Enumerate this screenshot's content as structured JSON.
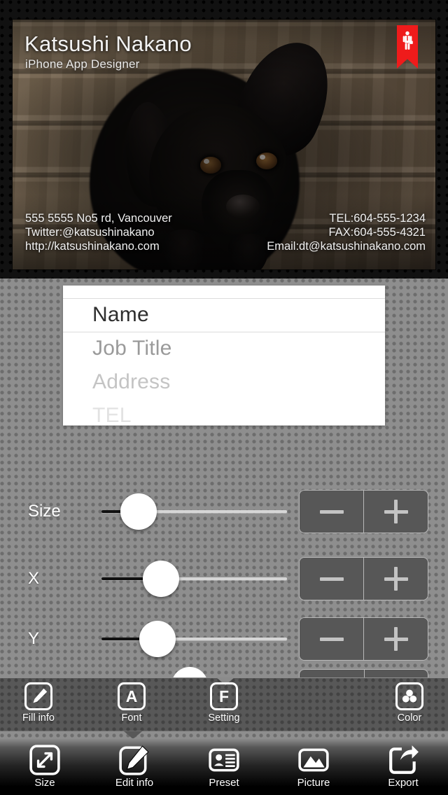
{
  "app": {
    "background_style": "dotted-gray"
  },
  "preview": {
    "card": {
      "name": "Katsushi Nakano",
      "job_title": "iPhone App Designer",
      "address": "555 5555 No5 rd, Vancouver",
      "twitter": "Twitter:@katsushinakano",
      "website": "http://katsushinakano.com",
      "tel": "TEL:604-555-1234",
      "fax": "FAX:604-555-4321",
      "email": "Email:dt@katsushinakano.com",
      "badge_icon": "businessman-bookmark-icon",
      "badge_color": "#ef1b1b",
      "photo": "black-labrador-puppy-on-wood"
    }
  },
  "picker": {
    "selected_index": 0,
    "items": [
      {
        "label": "Name"
      },
      {
        "label": "Job Title"
      },
      {
        "label": "Address"
      },
      {
        "label": "TEL"
      }
    ]
  },
  "sliders": [
    {
      "label": "Size",
      "value": 20,
      "min": 0,
      "max": 100,
      "minus_label": "−",
      "plus_label": "+"
    },
    {
      "label": "X",
      "value": 32,
      "min": 0,
      "max": 100,
      "minus_label": "−",
      "plus_label": "+"
    },
    {
      "label": "Y",
      "value": 30,
      "min": 0,
      "max": 100,
      "minus_label": "−",
      "plus_label": "+"
    }
  ],
  "toolbar_upper": {
    "items": [
      {
        "label": "Fill info",
        "icon": "pencil-square-icon",
        "glyph": ""
      },
      {
        "label": "Font",
        "icon": "letter-a-square-icon",
        "glyph": "A"
      },
      {
        "label": "Setting",
        "icon": "letter-f-square-icon",
        "glyph": "F"
      },
      {
        "label": "Color",
        "icon": "color-circles-icon",
        "glyph": ""
      }
    ]
  },
  "toolbar_bottom": {
    "items": [
      {
        "label": "Size",
        "icon": "resize-diagonal-icon"
      },
      {
        "label": "Edit info",
        "icon": "pencil-square-icon"
      },
      {
        "label": "Preset",
        "icon": "contact-card-icon"
      },
      {
        "label": "Picture",
        "icon": "image-mountain-icon"
      },
      {
        "label": "Export",
        "icon": "share-export-icon"
      }
    ]
  },
  "colors": {
    "accent_red": "#ef1b1b",
    "panel_white": "#ffffff",
    "bg_gray": "#8e8e8e",
    "toolbar_gray": "#585858"
  }
}
